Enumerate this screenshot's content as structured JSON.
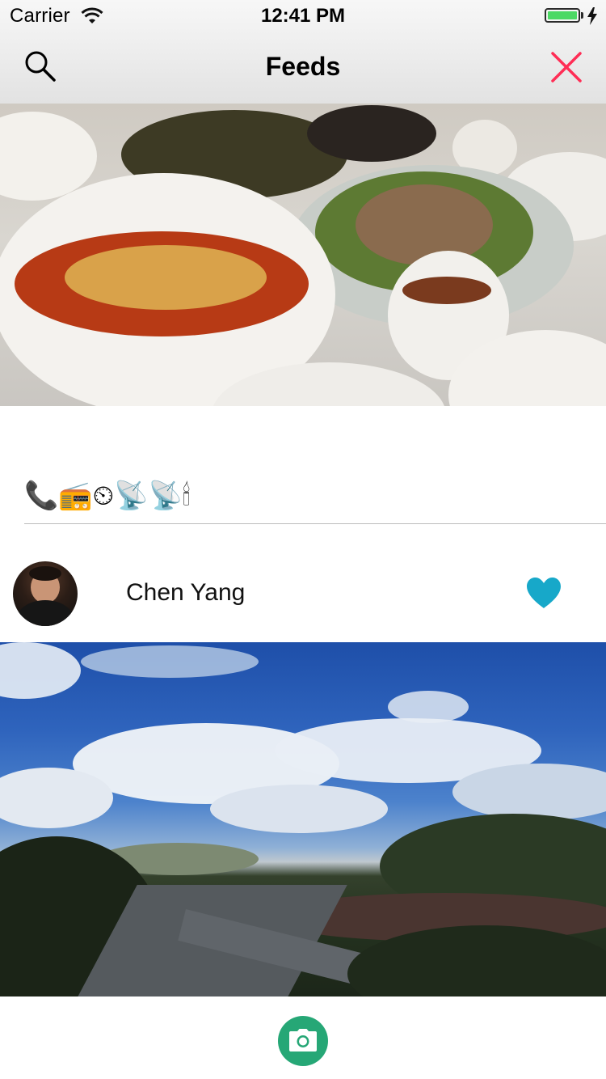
{
  "status_bar": {
    "carrier": "Carrier",
    "time": "12:41 PM",
    "battery_level": 1.0,
    "charging": true,
    "battery_color": "#4cd964"
  },
  "nav": {
    "title": "Feeds",
    "left_icon": "search-icon",
    "right_icon": "close-icon",
    "close_color": "#ff2d55"
  },
  "feed": {
    "items": [
      {
        "image": "food-photo",
        "caption": "📞📻⏲📡📡🕯"
      },
      {
        "user_name": "Chen Yang",
        "liked": true,
        "like_icon": "heart-icon",
        "like_color": "#17a8c9",
        "image": "landscape-photo"
      }
    ]
  },
  "footer": {
    "action_icon": "camera-icon",
    "action_color": "#26a776"
  }
}
